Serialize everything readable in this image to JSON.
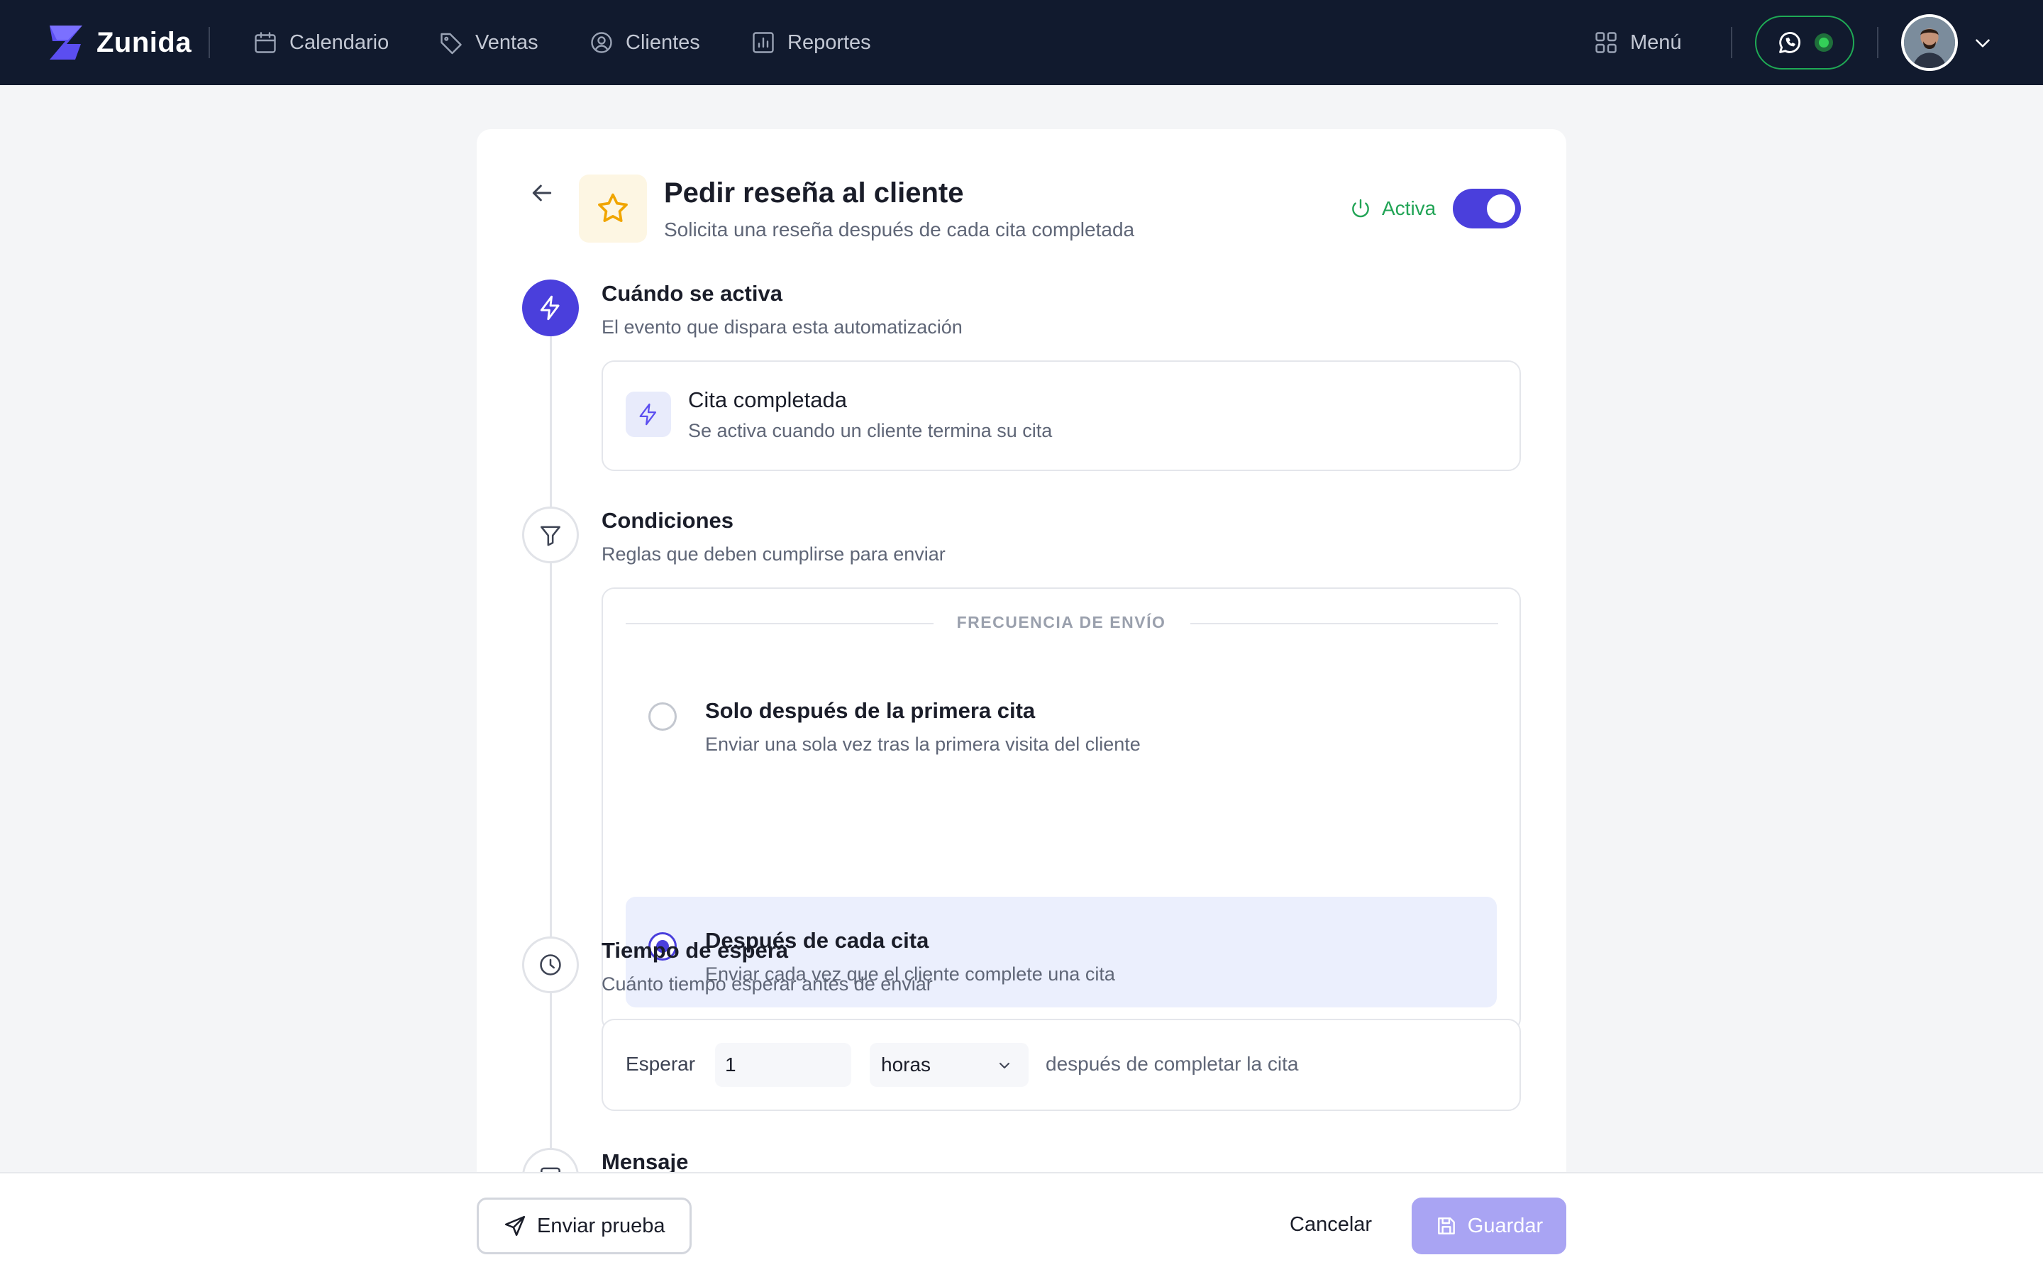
{
  "app": {
    "name": "Zunida"
  },
  "nav": {
    "items": [
      {
        "label": "Calendario",
        "icon": "calendar-icon"
      },
      {
        "label": "Ventas",
        "icon": "tag-icon"
      },
      {
        "label": "Clientes",
        "icon": "user-circle-icon"
      },
      {
        "label": "Reportes",
        "icon": "bar-chart-icon"
      }
    ],
    "menu_label": "Menú"
  },
  "header": {
    "title": "Pedir reseña al cliente",
    "subtitle": "Solicita una reseña después de cada cita completada",
    "status_label": "Activa",
    "toggle_on": true
  },
  "steps": {
    "trigger": {
      "title": "Cuándo se activa",
      "description": "El evento que dispara esta automatización",
      "event_title": "Cita completada",
      "event_description": "Se activa cuando un cliente termina su cita"
    },
    "conditions": {
      "title": "Condiciones",
      "description": "Reglas que deben cumplirse para enviar",
      "section_label": "FRECUENCIA DE ENVÍO",
      "options": [
        {
          "title": "Solo después de la primera cita",
          "description": "Enviar una sola vez tras la primera visita del cliente",
          "selected": false
        },
        {
          "title": "Después de cada cita",
          "description": "Enviar cada vez que el cliente complete una cita",
          "selected": true
        }
      ]
    },
    "wait": {
      "title": "Tiempo de espera",
      "description": "Cuánto tiempo esperar antes de enviar",
      "prefix": "Esperar",
      "value": "1",
      "unit": "horas",
      "suffix": "después de completar la cita"
    },
    "message": {
      "title": "Mensaje"
    }
  },
  "footer": {
    "test_label": "Enviar prueba",
    "cancel_label": "Cancelar",
    "save_label": "Guardar"
  },
  "colors": {
    "nav_bg": "#111a2e",
    "accent": "#4a3fdc",
    "success": "#22a456",
    "whatsapp": "#1faa55",
    "save_disabled": "#a9a4f3"
  }
}
